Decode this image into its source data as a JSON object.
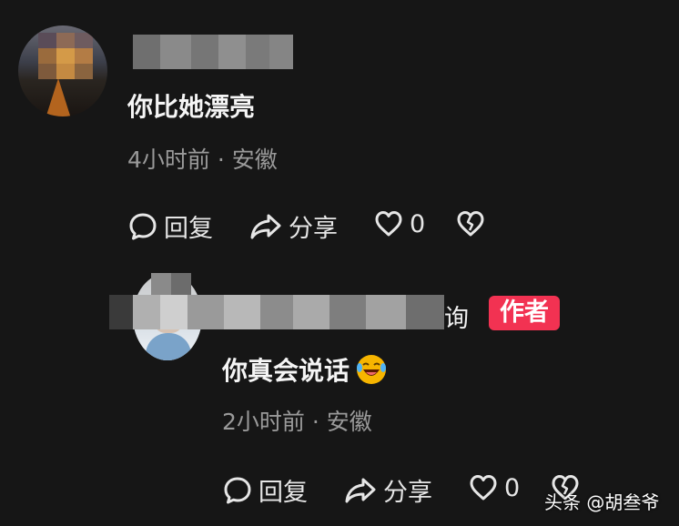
{
  "comments": [
    {
      "text": "你比她漂亮",
      "meta": "4小时前 · 安徽",
      "actions": {
        "reply": "回复",
        "share": "分享",
        "like_count": "0"
      }
    },
    {
      "name_tail": "询",
      "badge": "作者",
      "text": "你真会说话",
      "emoji": "laughing-crying-emoji",
      "meta": "2小时前 · 安徽",
      "actions": {
        "reply": "回复",
        "share": "分享",
        "like_count": "0"
      }
    }
  ],
  "watermark": "头条 @胡叁爷",
  "colors": {
    "background": "#161616",
    "badge": "#f23252",
    "meta": "#9a9a9a"
  }
}
